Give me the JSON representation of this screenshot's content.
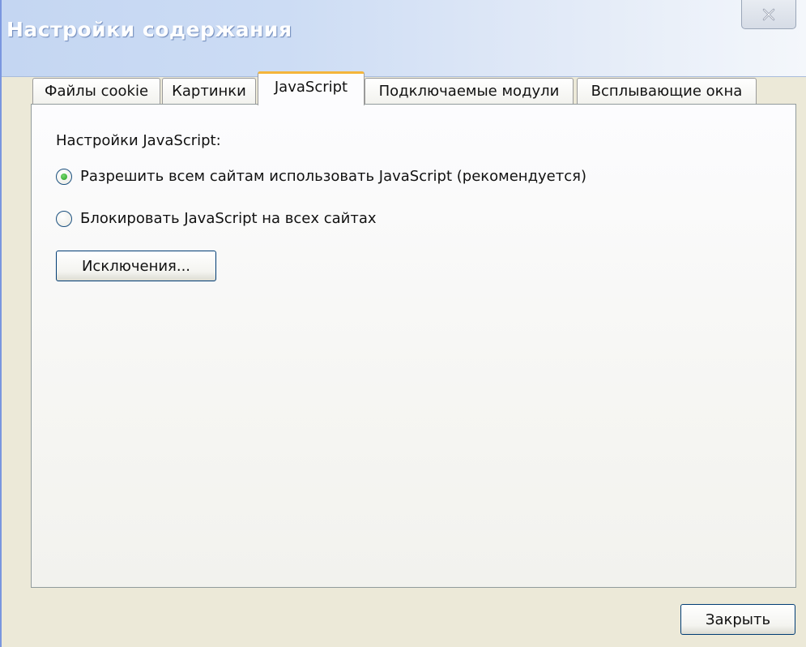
{
  "window": {
    "title": "Настройки содержания"
  },
  "tabs": [
    {
      "label": "Файлы cookie",
      "active": false
    },
    {
      "label": "Картинки",
      "active": false
    },
    {
      "label": "JavaScript",
      "active": true
    },
    {
      "label": "Подключаемые модули",
      "active": false
    },
    {
      "label": "Всплывающие окна",
      "active": false
    }
  ],
  "javascript": {
    "section_label": "Настройки JavaScript:",
    "options": [
      {
        "label": "Разрешить всем сайтам использовать JavaScript (рекомендуется)",
        "checked": true
      },
      {
        "label": "Блокировать JavaScript на всех сайтах",
        "checked": false
      }
    ],
    "exceptions_label": "Исключения..."
  },
  "footer": {
    "close_label": "Закрыть"
  },
  "icons": {
    "close": "close-icon"
  },
  "colors": {
    "active_tab_accent": "#f4b53b",
    "radio_dot": "#21a121",
    "button_border": "#003c74"
  }
}
